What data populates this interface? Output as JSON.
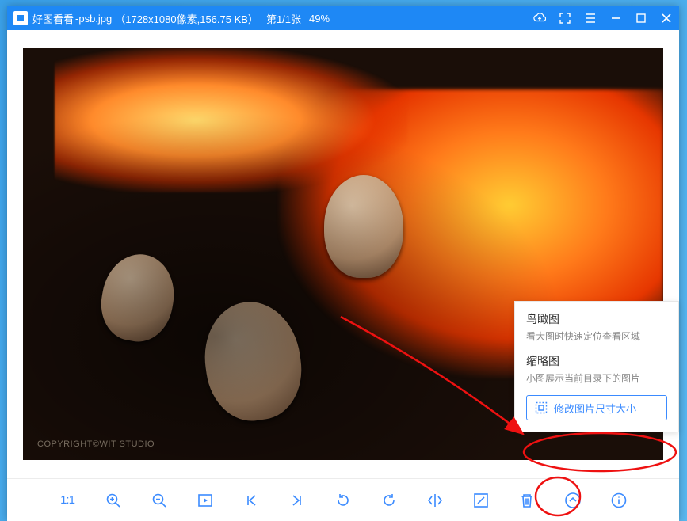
{
  "titlebar": {
    "app_name": "好图看看",
    "file_name": "-psb.jpg",
    "dimensions": "（1728x1080像素,156.75 KB）",
    "position": "第1/1张",
    "zoom": "49%"
  },
  "image": {
    "copyright": "COPYRIGHT©WIT STUDIO"
  },
  "popup": {
    "birdseye_title": "鸟瞰图",
    "birdseye_desc": "看大图时快速定位查看区域",
    "thumbnails_title": "缩略图",
    "thumbnails_desc": "小图展示当前目录下的图片",
    "resize_label": "修改图片尺寸大小"
  },
  "toolbar": {
    "one_to_one": "1:1"
  }
}
